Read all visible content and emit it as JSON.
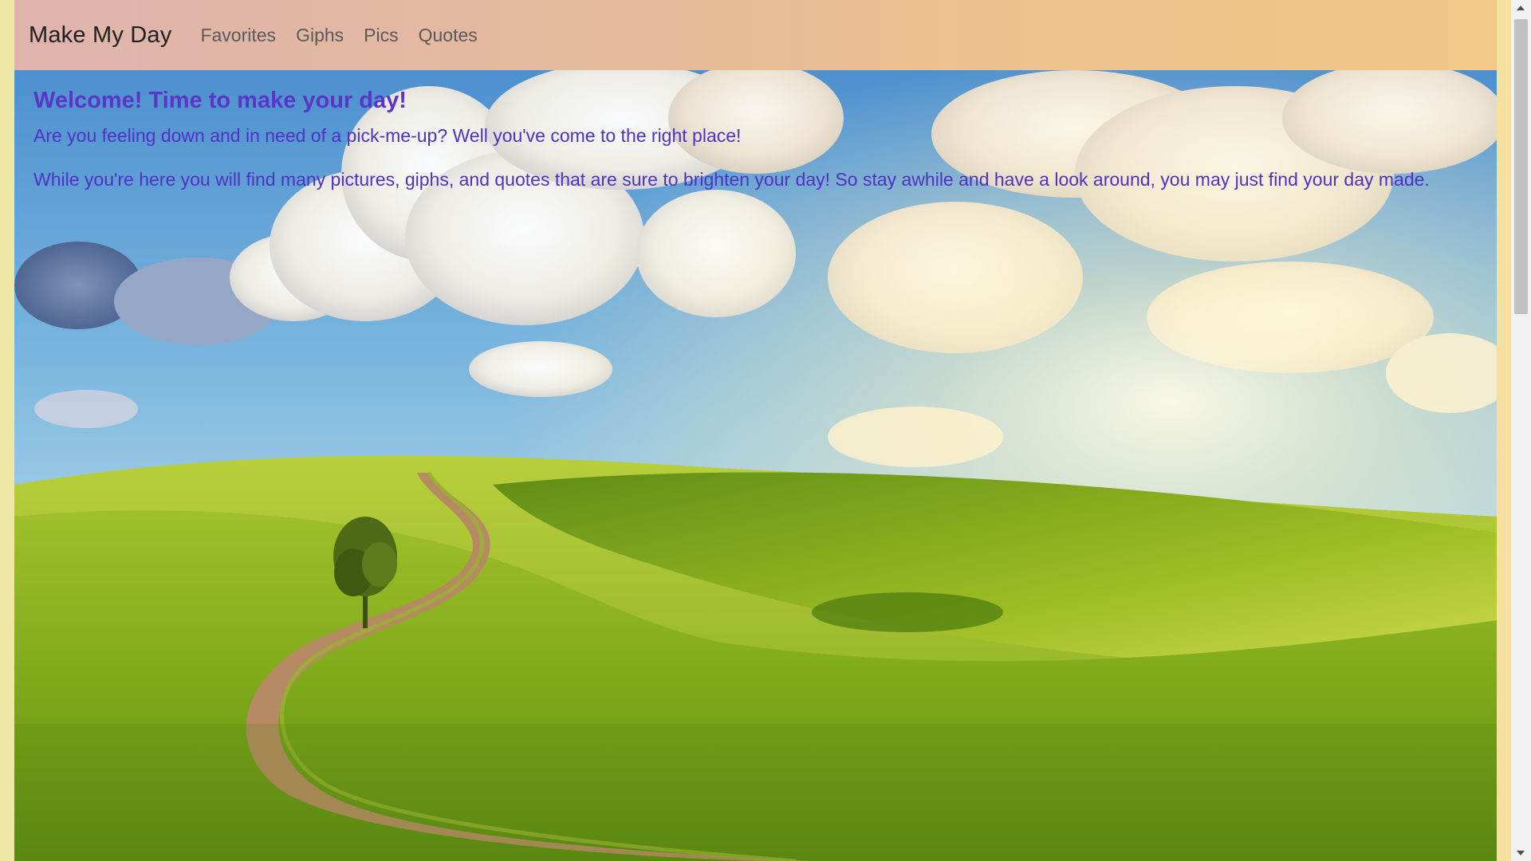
{
  "navbar": {
    "brand": "Make My Day",
    "links": [
      "Favorites",
      "Giphs",
      "Pics",
      "Quotes"
    ]
  },
  "hero": {
    "title": "Welcome! Time to make your day!",
    "paragraphs": [
      "Are you feeling down and in need of a pick-me-up? Well you've come to the right place!",
      "While you're here you will find many pictures, giphs, and quotes that are sure to brighten your day! So stay awhile and have a look around, you may just find your day made."
    ],
    "background_image": "sunny-meadow-with-winding-dirt-road"
  },
  "colors": {
    "navbar_start": "#dfb4ad",
    "navbar_end": "#f1c885",
    "text_accent": "#5a35c8"
  }
}
